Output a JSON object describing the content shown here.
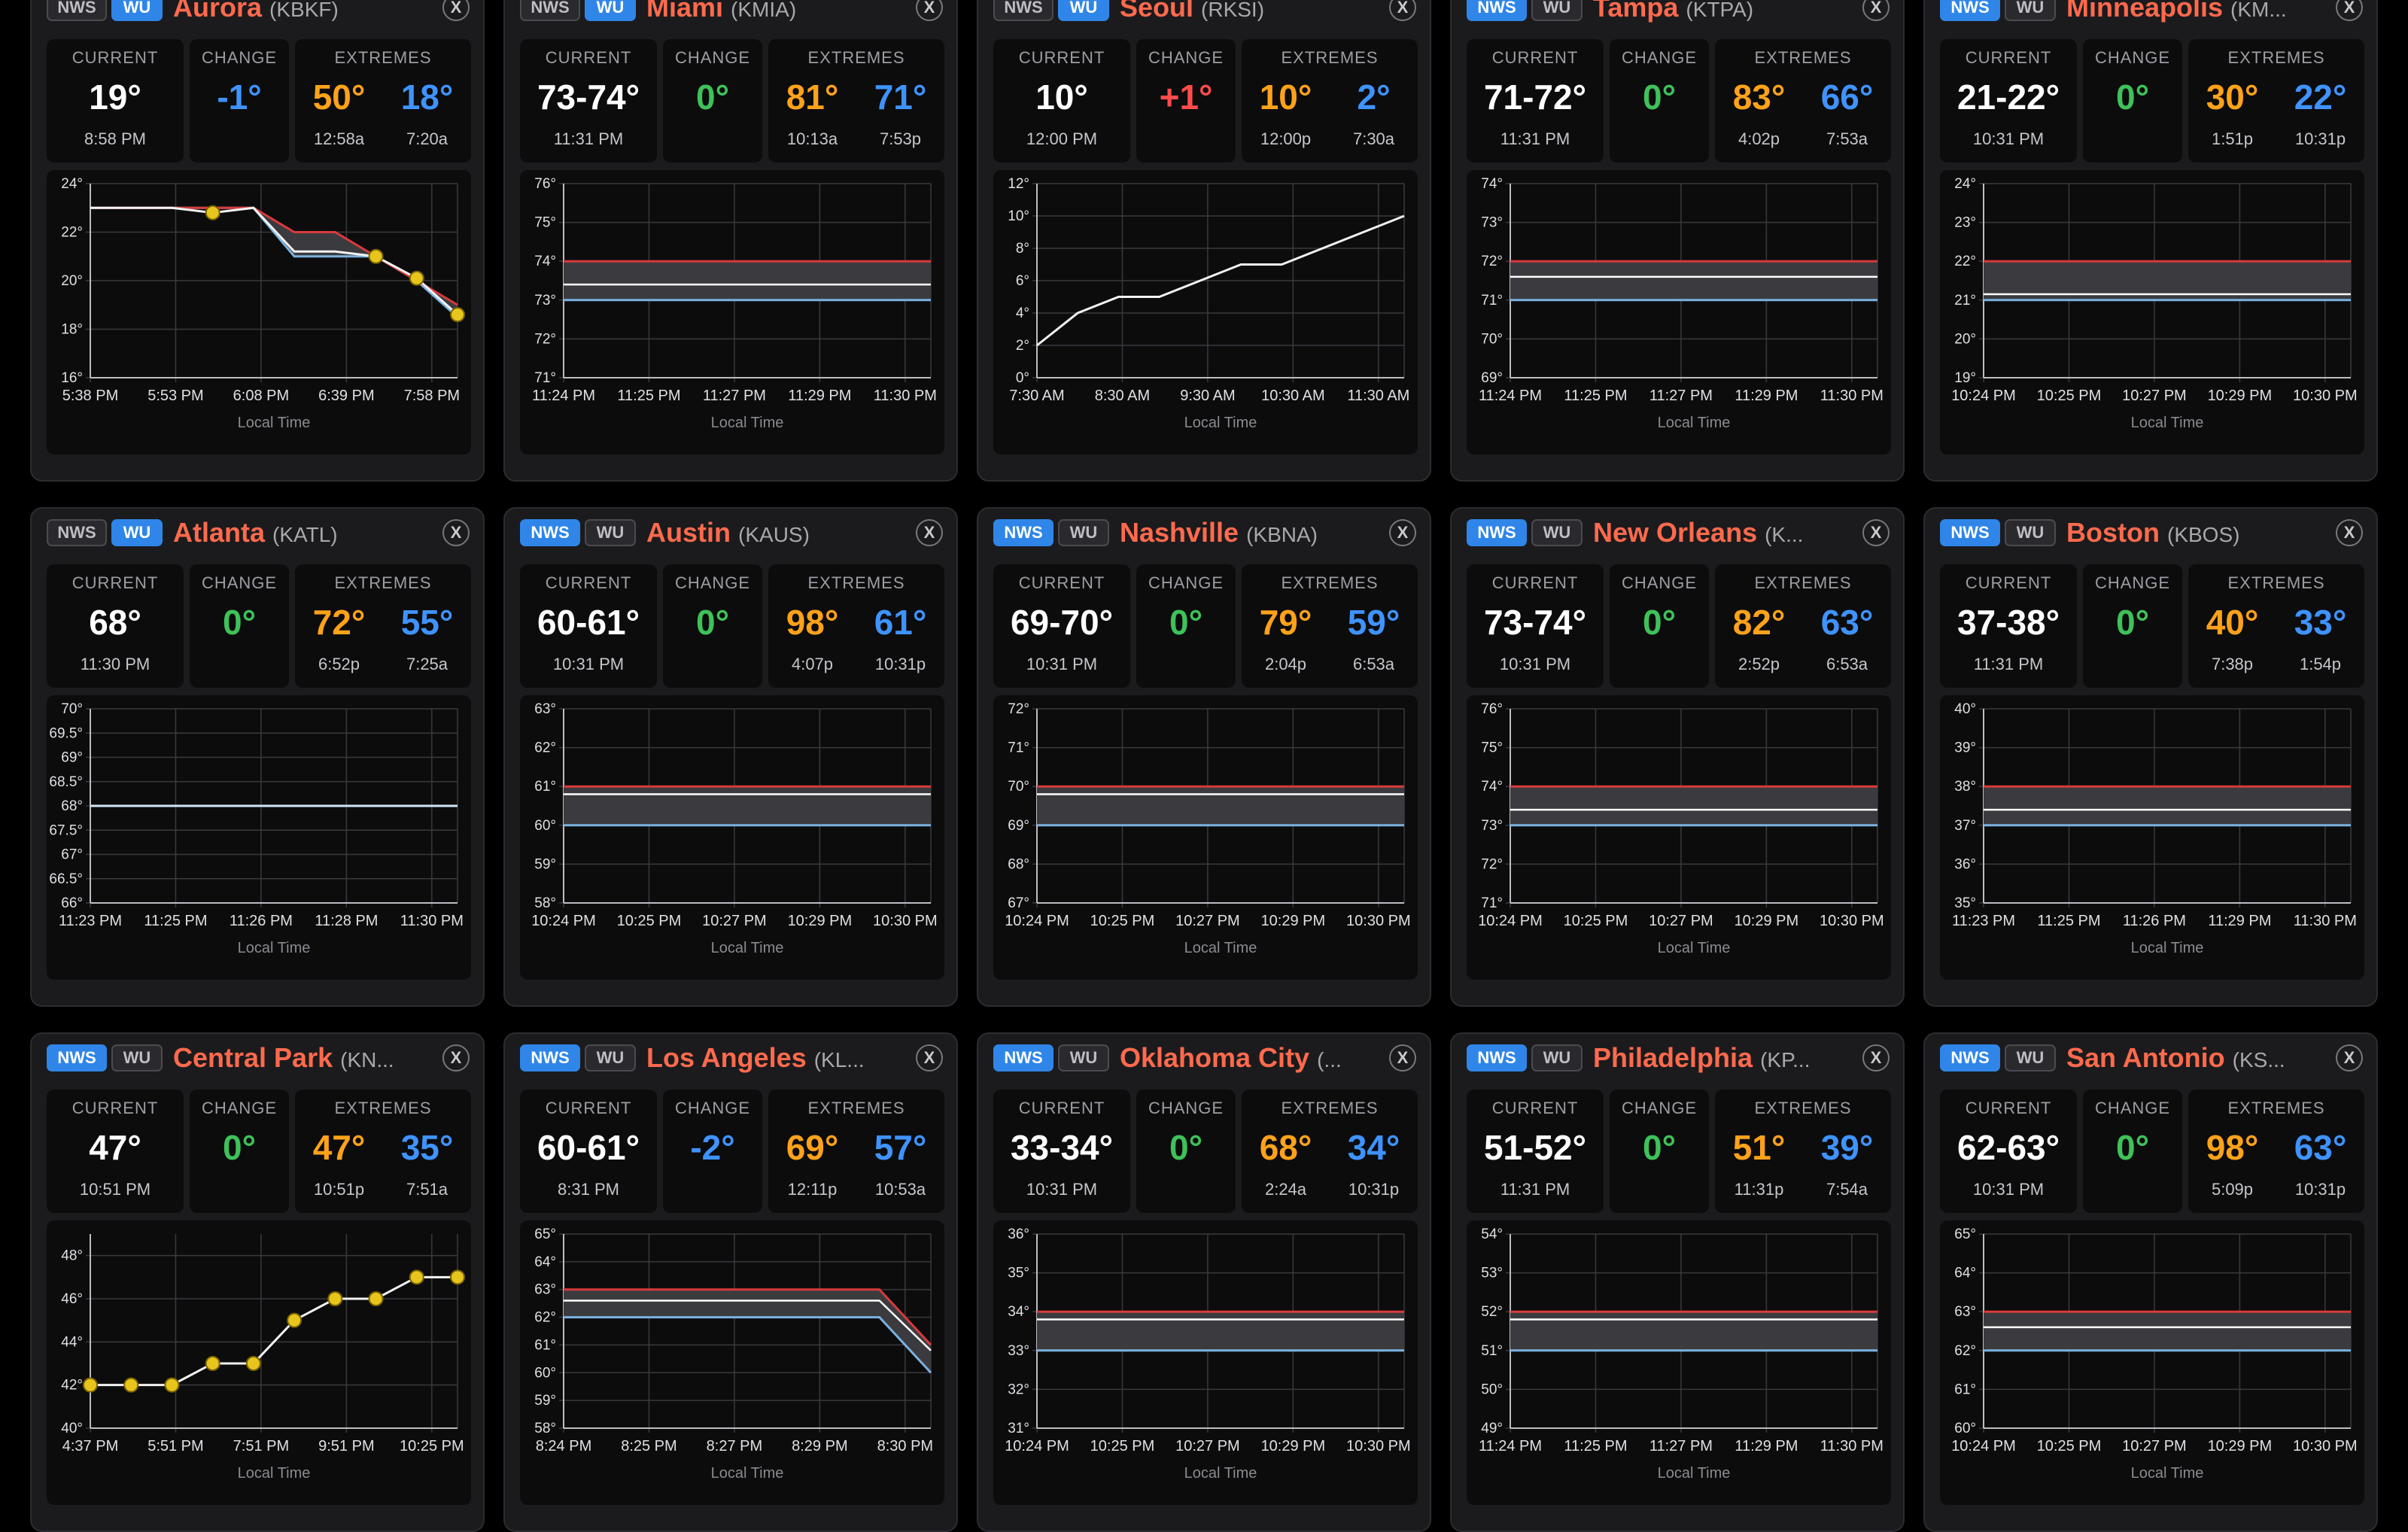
{
  "ui": {
    "current_label": "CURRENT",
    "change_label": "CHANGE",
    "extremes_label": "EXTREMES",
    "nws_label": "NWS",
    "wu_label": "WU",
    "close_glyph": "X",
    "xaxis_title": "Local Time"
  },
  "colors": {
    "card_bg": "#1b1b1d",
    "city_name": "#ff6a4d",
    "toggle_active": "#2f86e8",
    "high": "#ffa21a",
    "low": "#3f93ff",
    "change_zero": "#3ec259",
    "change_up": "#ff4b4b",
    "change_down": "#3f93ff",
    "range_top_line": "#d93a3a",
    "range_bottom_line": "#7ab2e0",
    "point_marker": "#e8c51c"
  },
  "cards": [
    {
      "city": "Aurora",
      "code": "(KBKF)",
      "active": "wu",
      "current": "19°",
      "time": "8:58 PM",
      "change": "-1°",
      "change_color": "blue",
      "high": "50°",
      "high_time": "12:58a",
      "low": "18°",
      "low_time": "7:20a",
      "chart_data": {
        "type": "line",
        "ytick_labels": [
          "16°",
          "18°",
          "20°",
          "22°",
          "24°"
        ],
        "ylim": [
          16,
          24
        ],
        "xlabels": [
          "5:38 PM",
          "5:53 PM",
          "6:08 PM",
          "6:39 PM",
          "7:58 PM"
        ],
        "x": [
          "5:38 PM",
          "5:53 PM",
          "6:08 PM",
          "6:39 PM",
          "7:58 PM"
        ],
        "band_upper": [
          23,
          23,
          23,
          23,
          23,
          22,
          22,
          21,
          20,
          19
        ],
        "band_lower": [
          23,
          23,
          23,
          23,
          23,
          21,
          21,
          21,
          20,
          18.5
        ],
        "obs": [
          23,
          23,
          23,
          22.8,
          23,
          21.2,
          21.2,
          21,
          20.1,
          18.6
        ],
        "markers": [
          3,
          7,
          8,
          9
        ]
      }
    },
    {
      "city": "Miami",
      "code": "(KMIA)",
      "active": "wu",
      "current": "73-74°",
      "time": "11:31 PM",
      "change": "0°",
      "change_color": "green",
      "high": "81°",
      "high_time": "10:13a",
      "low": "71°",
      "low_time": "7:53p",
      "chart_data": {
        "type": "range",
        "ytick_labels": [
          "71°",
          "72°",
          "73°",
          "74°",
          "75°",
          "76°"
        ],
        "ylim": [
          71,
          76
        ],
        "xlabels": [
          "11:24 PM",
          "11:25 PM",
          "11:27 PM",
          "11:29 PM",
          "11:30 PM"
        ],
        "upper": 74,
        "mid": 73.4,
        "lower": 73
      }
    },
    {
      "city": "Seoul",
      "code": "(RKSI)",
      "active": "wu",
      "current": "10°",
      "time": "12:00 PM",
      "change": "+1°",
      "change_color": "red",
      "high": "10°",
      "high_time": "12:00p",
      "low": "2°",
      "low_time": "7:30a",
      "chart_data": {
        "type": "line",
        "ytick_labels": [
          "0°",
          "2°",
          "4°",
          "6°",
          "8°",
          "10°",
          "12°"
        ],
        "ylim": [
          0,
          12
        ],
        "xlabels": [
          "7:30 AM",
          "8:30 AM",
          "9:30 AM",
          "10:30 AM",
          "11:30 AM"
        ],
        "obs": [
          2,
          4,
          5,
          5,
          6,
          7,
          7,
          8,
          9,
          10
        ],
        "markers": []
      }
    },
    {
      "city": "Tampa",
      "code": "(KTPA)",
      "active": "nws",
      "current": "71-72°",
      "time": "11:31 PM",
      "change": "0°",
      "change_color": "green",
      "high": "83°",
      "high_time": "4:02p",
      "low": "66°",
      "low_time": "7:53a",
      "chart_data": {
        "type": "range",
        "ytick_labels": [
          "69°",
          "70°",
          "71°",
          "72°",
          "73°",
          "74°"
        ],
        "ylim": [
          69,
          74
        ],
        "xlabels": [
          "11:24 PM",
          "11:25 PM",
          "11:27 PM",
          "11:29 PM",
          "11:30 PM"
        ],
        "upper": 72,
        "mid": 71.6,
        "lower": 71
      }
    },
    {
      "city": "Minneapolis",
      "code": "(KM...",
      "active": "nws",
      "current": "21-22°",
      "time": "10:31 PM",
      "change": "0°",
      "change_color": "green",
      "high": "30°",
      "high_time": "1:51p",
      "low": "22°",
      "low_time": "10:31p",
      "chart_data": {
        "type": "range",
        "ytick_labels": [
          "19°",
          "20°",
          "21°",
          "22°",
          "23°",
          "24°"
        ],
        "ylim": [
          19,
          24
        ],
        "xlabels": [
          "10:24 PM",
          "10:25 PM",
          "10:27 PM",
          "10:29 PM",
          "10:30 PM"
        ],
        "upper": 22,
        "mid": 21.15,
        "lower": 21
      }
    },
    {
      "city": "Atlanta",
      "code": "(KATL)",
      "active": "wu",
      "current": "68°",
      "time": "11:30 PM",
      "change": "0°",
      "change_color": "green",
      "high": "72°",
      "high_time": "6:52p",
      "low": "55°",
      "low_time": "7:25a",
      "chart_data": {
        "type": "flat",
        "ytick_labels": [
          "66°",
          "66.5°",
          "67°",
          "67.5°",
          "68°",
          "68.5°",
          "69°",
          "69.5°",
          "70°"
        ],
        "ylim": [
          66,
          70
        ],
        "xlabels": [
          "11:23 PM",
          "11:25 PM",
          "11:26 PM",
          "11:28 PM",
          "11:30 PM"
        ],
        "value": 68
      }
    },
    {
      "city": "Austin",
      "code": "(KAUS)",
      "active": "nws",
      "current": "60-61°",
      "time": "10:31 PM",
      "change": "0°",
      "change_color": "green",
      "high": "98°",
      "high_time": "4:07p",
      "low": "61°",
      "low_time": "10:31p",
      "chart_data": {
        "type": "range",
        "ytick_labels": [
          "58°",
          "59°",
          "60°",
          "61°",
          "62°",
          "63°"
        ],
        "ylim": [
          58,
          63
        ],
        "xlabels": [
          "10:24 PM",
          "10:25 PM",
          "10:27 PM",
          "10:29 PM",
          "10:30 PM"
        ],
        "upper": 61,
        "mid": 60.8,
        "lower": 60
      }
    },
    {
      "city": "Nashville",
      "code": "(KBNA)",
      "active": "nws",
      "current": "69-70°",
      "time": "10:31 PM",
      "change": "0°",
      "change_color": "green",
      "high": "79°",
      "high_time": "2:04p",
      "low": "59°",
      "low_time": "6:53a",
      "chart_data": {
        "type": "range",
        "ytick_labels": [
          "67°",
          "68°",
          "69°",
          "70°",
          "71°",
          "72°"
        ],
        "ylim": [
          67,
          72
        ],
        "xlabels": [
          "10:24 PM",
          "10:25 PM",
          "10:27 PM",
          "10:29 PM",
          "10:30 PM"
        ],
        "upper": 70,
        "mid": 69.8,
        "lower": 69
      }
    },
    {
      "city": "New Orleans",
      "code": "(K...",
      "active": "nws",
      "current": "73-74°",
      "time": "10:31 PM",
      "change": "0°",
      "change_color": "green",
      "high": "82°",
      "high_time": "2:52p",
      "low": "63°",
      "low_time": "6:53a",
      "chart_data": {
        "type": "range",
        "ytick_labels": [
          "71°",
          "72°",
          "73°",
          "74°",
          "75°",
          "76°"
        ],
        "ylim": [
          71,
          76
        ],
        "xlabels": [
          "10:24 PM",
          "10:25 PM",
          "10:27 PM",
          "10:29 PM",
          "10:30 PM"
        ],
        "upper": 74,
        "mid": 73.4,
        "lower": 73
      }
    },
    {
      "city": "Boston",
      "code": "(KBOS)",
      "active": "nws",
      "current": "37-38°",
      "time": "11:31 PM",
      "change": "0°",
      "change_color": "green",
      "high": "40°",
      "high_time": "7:38p",
      "low": "33°",
      "low_time": "1:54p",
      "chart_data": {
        "type": "range",
        "ytick_labels": [
          "35°",
          "36°",
          "37°",
          "38°",
          "39°",
          "40°"
        ],
        "ylim": [
          35,
          40
        ],
        "xlabels": [
          "11:23 PM",
          "11:25 PM",
          "11:26 PM",
          "11:29 PM",
          "11:30 PM"
        ],
        "upper": 38,
        "mid": 37.4,
        "lower": 37
      }
    },
    {
      "city": "Central Park",
      "code": "(KN...",
      "active": "nws",
      "current": "47°",
      "time": "10:51 PM",
      "change": "0°",
      "change_color": "green",
      "high": "47°",
      "high_time": "10:51p",
      "low": "35°",
      "low_time": "7:51a",
      "chart_data": {
        "type": "line",
        "ytick_labels": [
          "40°",
          "42°",
          "44°",
          "46°",
          "48°"
        ],
        "ylim": [
          40,
          49
        ],
        "xlabels": [
          "4:37 PM",
          "5:51 PM",
          "7:51 PM",
          "9:51 PM",
          "10:25 PM"
        ],
        "obs": [
          42,
          42,
          42,
          43,
          43,
          45,
          46,
          46,
          47,
          47
        ],
        "markers": [
          0,
          1,
          2,
          3,
          4,
          5,
          6,
          7,
          8,
          9
        ]
      }
    },
    {
      "city": "Los Angeles",
      "code": "(KL...",
      "active": "nws",
      "current": "60-61°",
      "time": "8:31 PM",
      "change": "-2°",
      "change_color": "blue",
      "high": "69°",
      "high_time": "12:11p",
      "low": "57°",
      "low_time": "10:53a",
      "chart_data": {
        "type": "dropband",
        "ytick_labels": [
          "58°",
          "59°",
          "60°",
          "61°",
          "62°",
          "63°",
          "64°",
          "65°"
        ],
        "ylim": [
          58,
          65
        ],
        "xlabels": [
          "8:24 PM",
          "8:25 PM",
          "8:27 PM",
          "8:29 PM",
          "8:30 PM"
        ],
        "upper": 63,
        "mid": 62.6,
        "lower": 62,
        "upper_end": 61,
        "mid_end": 60.8,
        "lower_end": 60
      }
    },
    {
      "city": "Oklahoma City",
      "code": "(...",
      "active": "nws",
      "current": "33-34°",
      "time": "10:31 PM",
      "change": "0°",
      "change_color": "green",
      "high": "68°",
      "high_time": "2:24a",
      "low": "34°",
      "low_time": "10:31p",
      "chart_data": {
        "type": "range",
        "ytick_labels": [
          "31°",
          "32°",
          "33°",
          "34°",
          "35°",
          "36°"
        ],
        "ylim": [
          31,
          36
        ],
        "xlabels": [
          "10:24 PM",
          "10:25 PM",
          "10:27 PM",
          "10:29 PM",
          "10:30 PM"
        ],
        "upper": 34,
        "mid": 33.8,
        "lower": 33
      }
    },
    {
      "city": "Philadelphia",
      "code": "(KP...",
      "active": "nws",
      "current": "51-52°",
      "time": "11:31 PM",
      "change": "0°",
      "change_color": "green",
      "high": "51°",
      "high_time": "11:31p",
      "low": "39°",
      "low_time": "7:54a",
      "chart_data": {
        "type": "range",
        "ytick_labels": [
          "49°",
          "50°",
          "51°",
          "52°",
          "53°",
          "54°"
        ],
        "ylim": [
          49,
          54
        ],
        "xlabels": [
          "11:24 PM",
          "11:25 PM",
          "11:27 PM",
          "11:29 PM",
          "11:30 PM"
        ],
        "upper": 52,
        "mid": 51.8,
        "lower": 51
      }
    },
    {
      "city": "San Antonio",
      "code": "(KS...",
      "active": "nws",
      "current": "62-63°",
      "time": "10:31 PM",
      "change": "0°",
      "change_color": "green",
      "high": "98°",
      "high_time": "5:09p",
      "low": "63°",
      "low_time": "10:31p",
      "chart_data": {
        "type": "range",
        "ytick_labels": [
          "60°",
          "61°",
          "62°",
          "63°",
          "64°",
          "65°"
        ],
        "ylim": [
          60,
          65
        ],
        "xlabels": [
          "10:24 PM",
          "10:25 PM",
          "10:27 PM",
          "10:29 PM",
          "10:30 PM"
        ],
        "upper": 63,
        "mid": 62.6,
        "lower": 62
      }
    }
  ]
}
